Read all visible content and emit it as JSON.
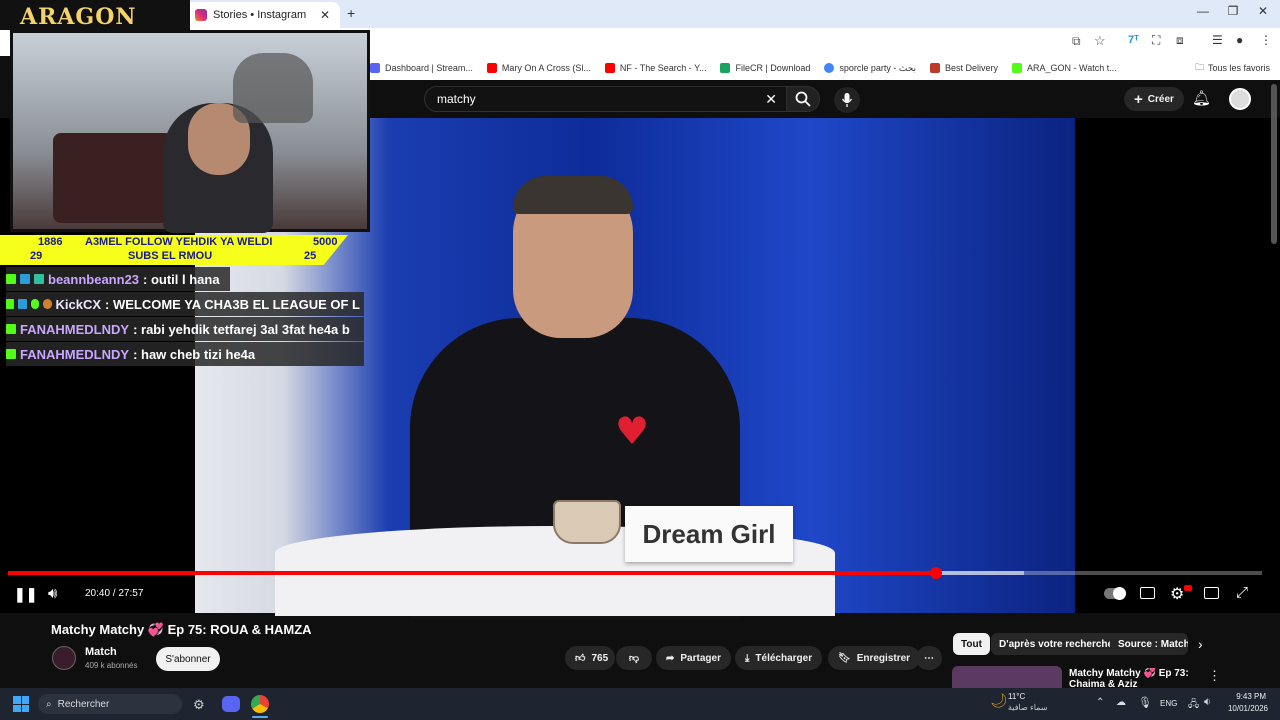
{
  "browser": {
    "tab_title": "Stories • Instagram",
    "bookmarks": [
      {
        "label": "Dashboard | Stream...",
        "color": "#5865f2"
      },
      {
        "label": "Mary On A Cross (Sl...",
        "color": "#ff0000"
      },
      {
        "label": "NF - The Search - Y...",
        "color": "#ff0000"
      },
      {
        "label": "FileCR | Download",
        "color": "#1aa260"
      },
      {
        "label": "sporcle party - بحث",
        "color": "#4285f4"
      },
      {
        "label": "Best Delivery",
        "color": "#c0392b"
      },
      {
        "label": "ARA_GON - Watch t...",
        "color": "#53fc18"
      }
    ],
    "all_favorites": "Tous les favoris"
  },
  "youtube": {
    "search_value": "matchy",
    "create_label": "Créer",
    "time": "20:40 / 27:57",
    "progress_played": 0.74,
    "progress_buffered": 0.81,
    "video_title": "Matchy Matchy 💞 Ep 75: ROUA & HAMZA",
    "channel": "Match",
    "subscribers": "409 k abonnés",
    "subscribe_label": "S'abonner",
    "likes": "765",
    "share_label": "Partager",
    "download_label": "Télécharger",
    "save_label": "Enregistrer",
    "chips": [
      "Tout",
      "D'après votre recherche",
      "Source : Match"
    ],
    "next_title": "Matchy Matchy 💞 Ep 73: Chaima & Aziz",
    "sign_text": "Dream Girl"
  },
  "overlay": {
    "logo": "ARAGON",
    "follow_left": "1886",
    "follow_text": "A3MEL FOLLOW YEHDIK YA WELDI",
    "follow_right": "5000",
    "subs_left": "29",
    "subs_text": "SUBS EL RMOU",
    "subs_right": "25",
    "chat": [
      {
        "user": "beannbeann23",
        "msg": ": outil l hana"
      },
      {
        "user": "KickCX",
        "msg": ": WELCOME YA CHA3B EL LEAGUE OF L"
      },
      {
        "user": "FANAHMEDLNDY",
        "msg": ": rabi yehdik tetfarej 3al 3fat he4a b"
      },
      {
        "user": "FANAHMEDLNDY",
        "msg": ": haw cheb tizi he4a"
      }
    ]
  },
  "taskbar": {
    "search_label": "Rechercher",
    "weather_temp": "11°C",
    "weather_text": "سماء صافية",
    "lang": "ENG",
    "clock_time": "9:43 PM",
    "clock_date": "10/01/2026"
  }
}
